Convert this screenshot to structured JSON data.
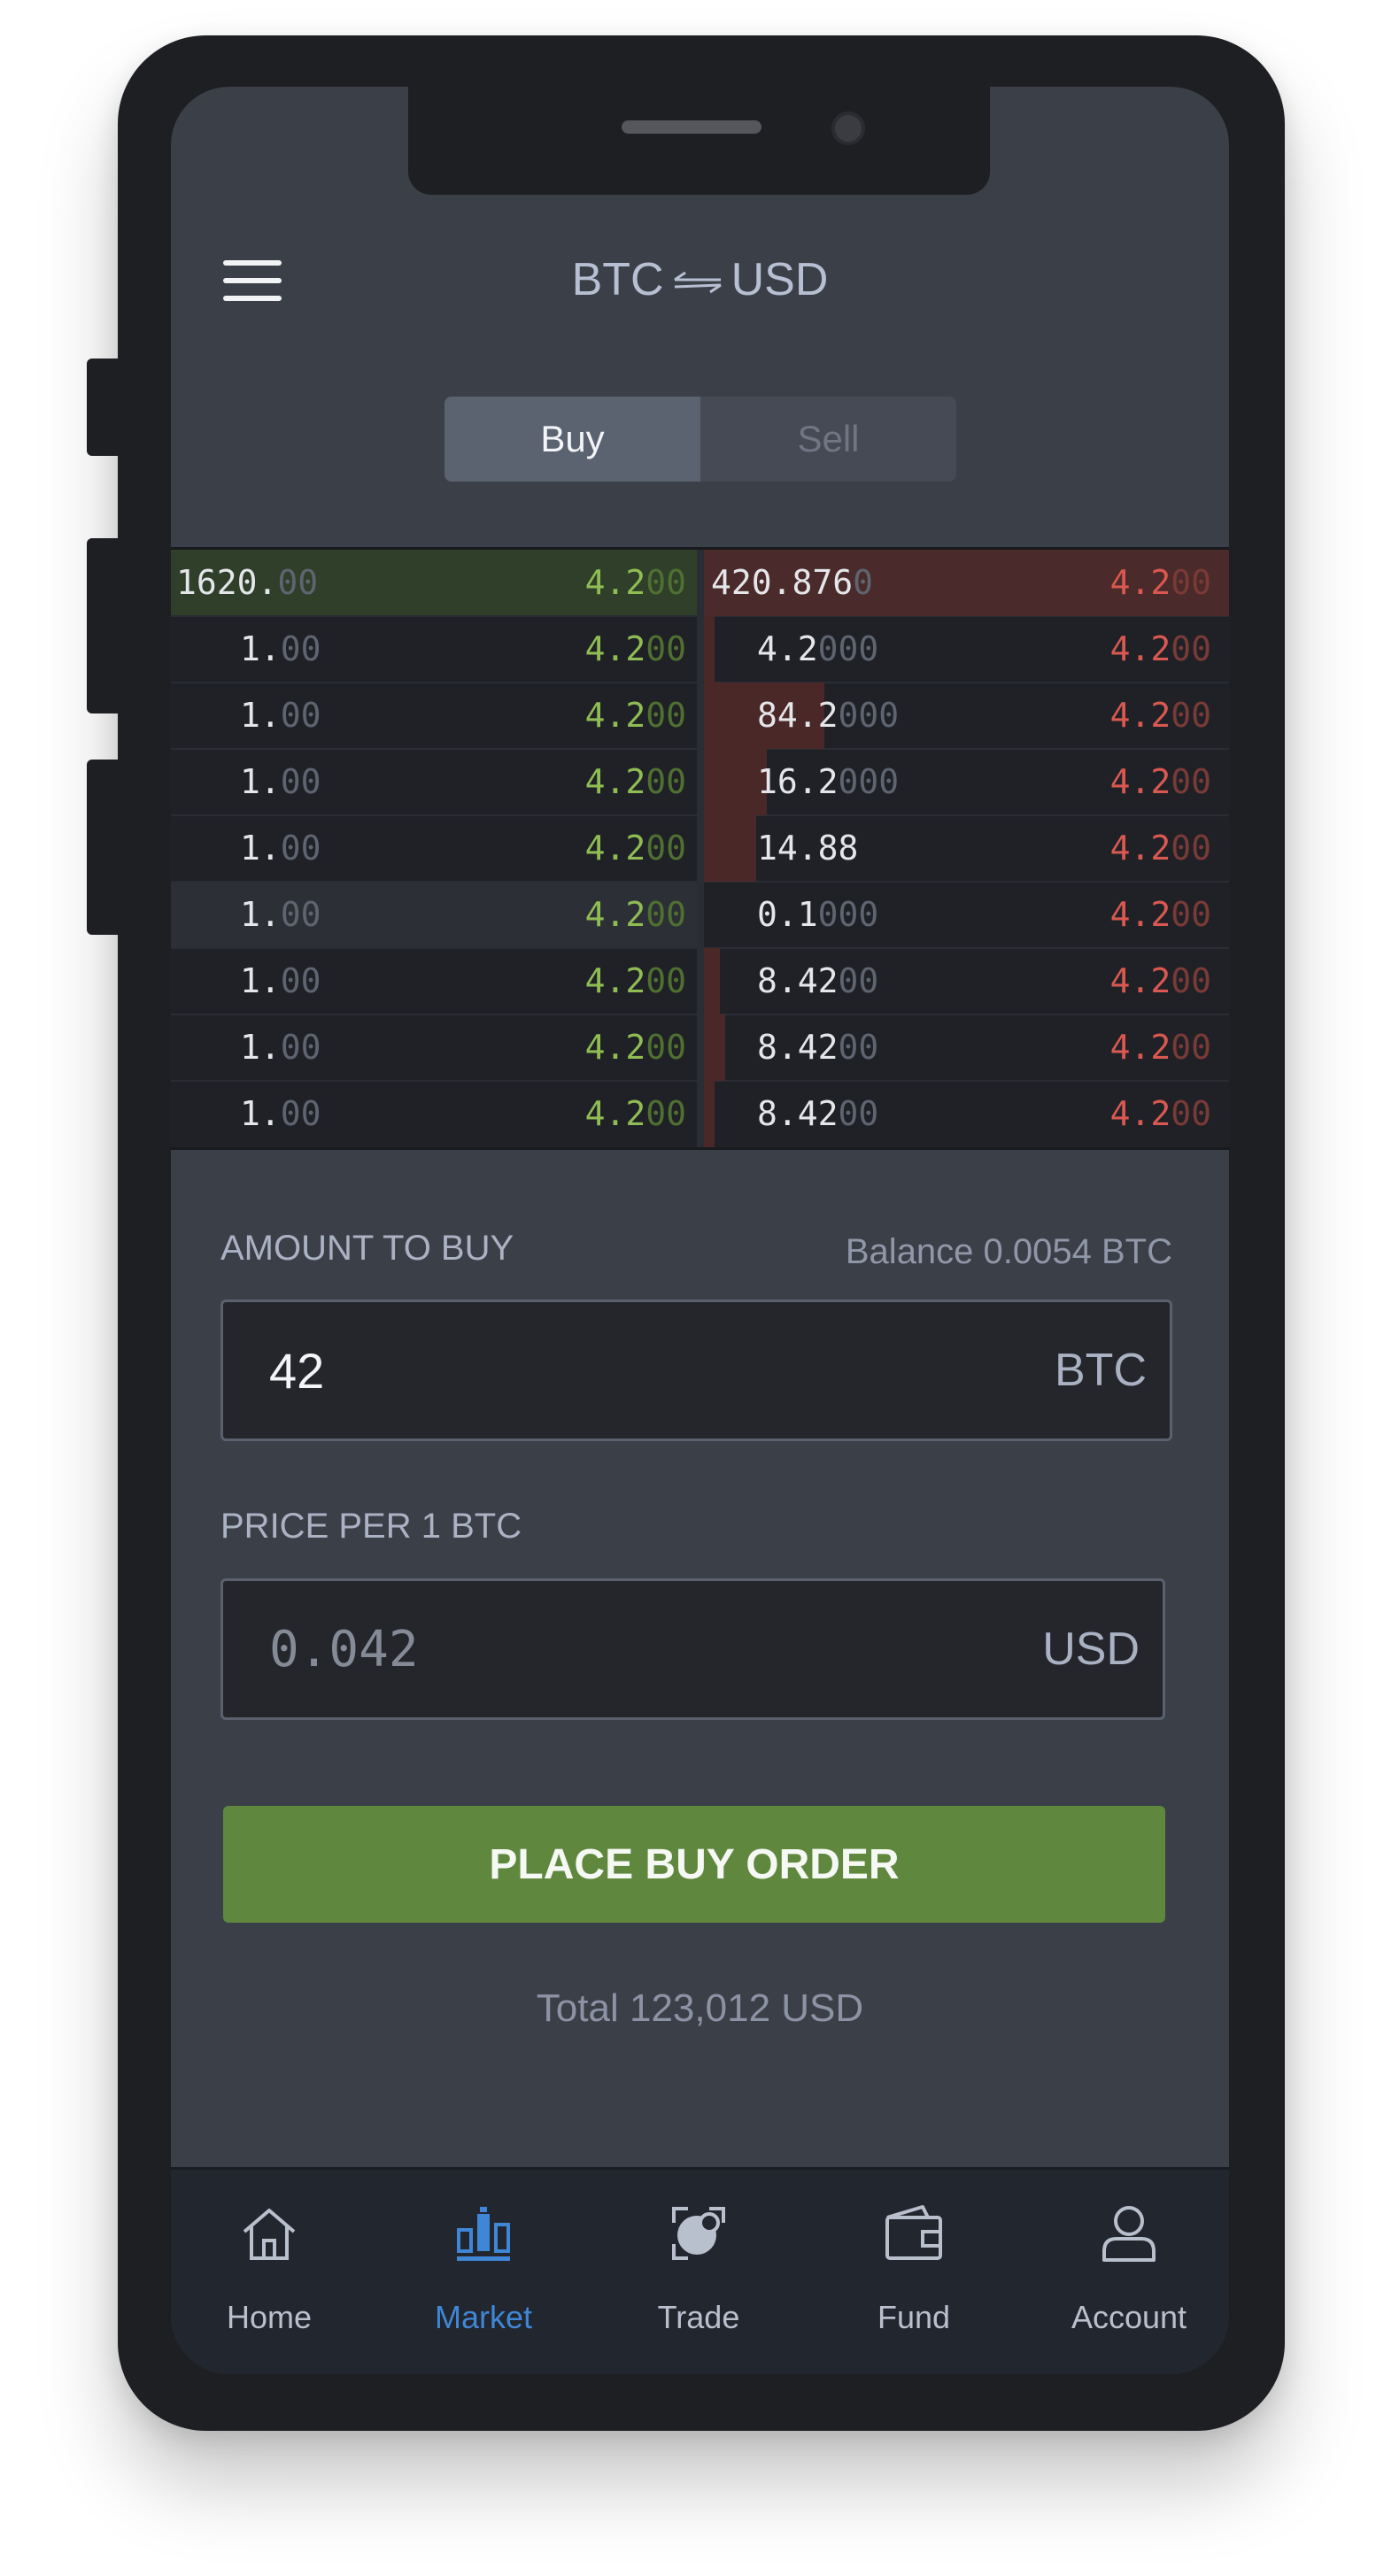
{
  "header": {
    "base": "BTC",
    "quote": "USD"
  },
  "tabs": [
    {
      "label": "Buy",
      "active": true
    },
    {
      "label": "Sell",
      "active": false
    }
  ],
  "order_book": {
    "bids": [
      {
        "price_main": "1620.",
        "price_dim": "00",
        "qty_main": "4.2",
        "qty_dim": "00"
      },
      {
        "price_main": "1.",
        "price_dim": "00",
        "qty_main": "4.2",
        "qty_dim": "00"
      },
      {
        "price_main": "1.",
        "price_dim": "00",
        "qty_main": "4.2",
        "qty_dim": "00"
      },
      {
        "price_main": "1.",
        "price_dim": "00",
        "qty_main": "4.2",
        "qty_dim": "00"
      },
      {
        "price_main": "1.",
        "price_dim": "00",
        "qty_main": "4.2",
        "qty_dim": "00"
      },
      {
        "price_main": "1.",
        "price_dim": "00",
        "qty_main": "4.2",
        "qty_dim": "00"
      },
      {
        "price_main": "1.",
        "price_dim": "00",
        "qty_main": "4.2",
        "qty_dim": "00"
      },
      {
        "price_main": "1.",
        "price_dim": "00",
        "qty_main": "4.2",
        "qty_dim": "00"
      },
      {
        "price_main": "1.",
        "price_dim": "00",
        "qty_main": "4.2",
        "qty_dim": "00"
      }
    ],
    "asks": [
      {
        "price_main": "420.876",
        "price_dim": "0",
        "qty_main": "4.2",
        "qty_dim": "00"
      },
      {
        "price_main": "4.2",
        "price_dim": "000",
        "qty_main": "4.2",
        "qty_dim": "00"
      },
      {
        "price_main": "84.2",
        "price_dim": "000",
        "qty_main": "4.2",
        "qty_dim": "00"
      },
      {
        "price_main": "16.2",
        "price_dim": "000",
        "qty_main": "4.2",
        "qty_dim": "00"
      },
      {
        "price_main": "14.88",
        "price_dim": "",
        "qty_main": "4.2",
        "qty_dim": "00"
      },
      {
        "price_main": "0.1",
        "price_dim": "000",
        "qty_main": "4.2",
        "qty_dim": "00"
      },
      {
        "price_main": "8.42",
        "price_dim": "00",
        "qty_main": "4.2",
        "qty_dim": "00"
      },
      {
        "price_main": "8.42",
        "price_dim": "00",
        "qty_main": "4.2",
        "qty_dim": "00"
      },
      {
        "price_main": "8.42",
        "price_dim": "00",
        "qty_main": "4.2",
        "qty_dim": "00"
      }
    ],
    "ask_depth_fraction": [
      1.0,
      0.02,
      0.23,
      0.12,
      0.1,
      0.0,
      0.03,
      0.04,
      0.02
    ],
    "bid_highlight_rows": [
      0,
      5
    ]
  },
  "form": {
    "amount_label": "AMOUNT TO BUY",
    "balance": "Balance 0.0054 BTC",
    "amount_value": "42",
    "amount_unit": "BTC",
    "price_label": "PRICE PER 1 BTC",
    "price_placeholder": "0.042",
    "price_unit": "USD",
    "submit_label": "PLACE BUY ORDER",
    "total_label": "Total",
    "total_value": "123,012",
    "total_unit": "USD"
  },
  "nav": [
    {
      "label": "Home",
      "icon": "home-icon",
      "active": false
    },
    {
      "label": "Market",
      "icon": "market-icon",
      "active": true
    },
    {
      "label": "Trade",
      "icon": "trade-icon",
      "active": false
    },
    {
      "label": "Fund",
      "icon": "wallet-icon",
      "active": false
    },
    {
      "label": "Account",
      "icon": "account-icon",
      "active": false
    }
  ],
  "colors": {
    "bid": "#8fbd53",
    "ask": "#d9584f",
    "accent": "#3f87d6",
    "button": "#5f883e"
  }
}
